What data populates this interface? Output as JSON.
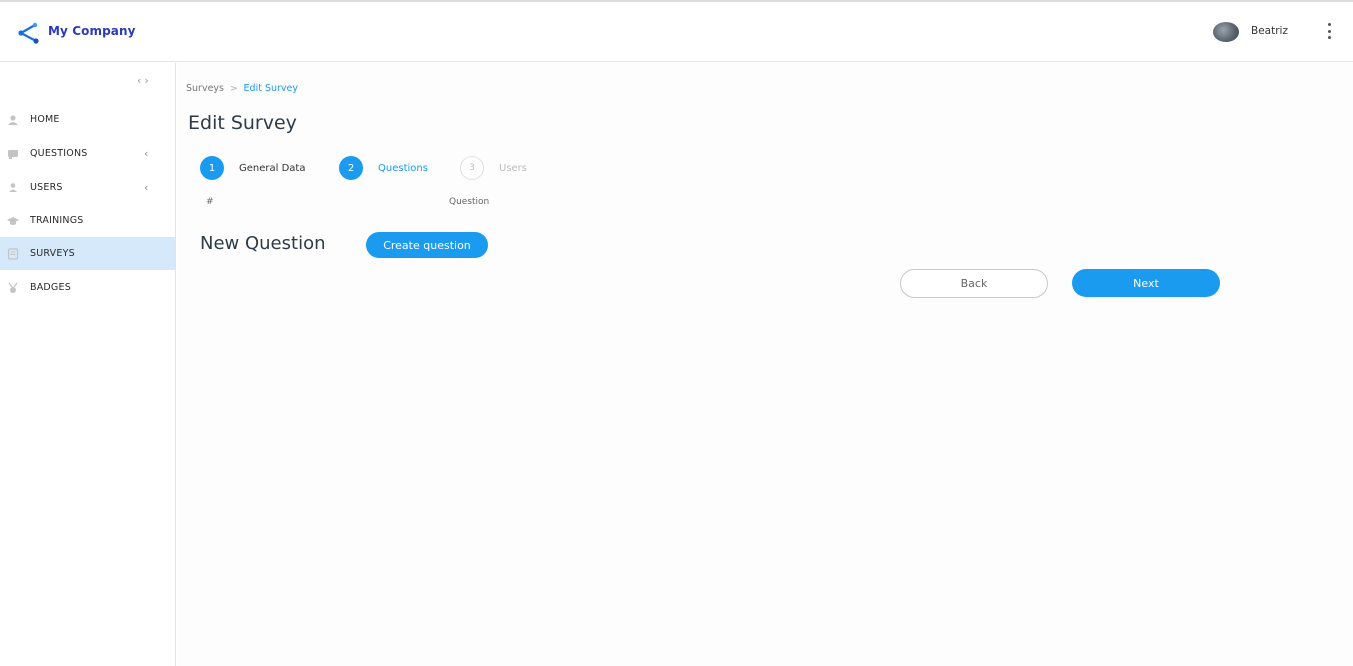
{
  "header": {
    "brand": "My Company",
    "username": "Beatriz"
  },
  "sidebar": {
    "items": [
      {
        "label": "HOME",
        "icon": "home-icon",
        "chevron": false,
        "active": false
      },
      {
        "label": "QUESTIONS",
        "icon": "questions-icon",
        "chevron": true,
        "active": false
      },
      {
        "label": "USERS",
        "icon": "user-icon",
        "chevron": true,
        "active": false
      },
      {
        "label": "TRAININGS",
        "icon": "graduation-cap-icon",
        "chevron": false,
        "active": false
      },
      {
        "label": "SURVEYS",
        "icon": "survey-icon",
        "chevron": false,
        "active": true
      },
      {
        "label": "BADGES",
        "icon": "badge-icon",
        "chevron": false,
        "active": false
      }
    ]
  },
  "breadcrumb": {
    "parent": "Surveys",
    "separator": ">",
    "current": "Edit Survey"
  },
  "page": {
    "title": "Edit Survey"
  },
  "steps": [
    {
      "number": "1",
      "label": "General Data",
      "state": "done"
    },
    {
      "number": "2",
      "label": "Questions",
      "state": "active"
    },
    {
      "number": "3",
      "label": "Users",
      "state": "pending"
    }
  ],
  "table": {
    "headers": [
      "#",
      "Question"
    ]
  },
  "new_question": {
    "title": "New Question",
    "create_label": "Create question"
  },
  "nav_buttons": {
    "back": "Back",
    "next": "Next"
  },
  "colors": {
    "accent": "#1a9bf0",
    "brand": "#2b3bb8",
    "active_nav_bg": "#d5e9fb"
  }
}
